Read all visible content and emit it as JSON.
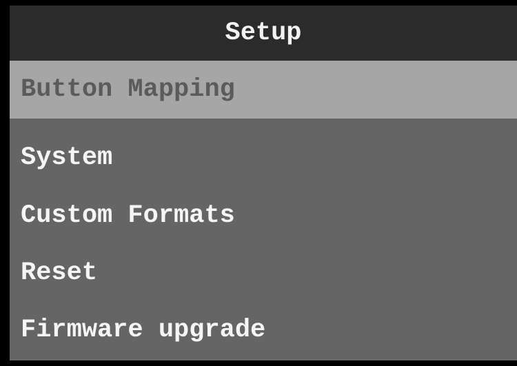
{
  "header": {
    "title": "Setup"
  },
  "menu": {
    "selected_index": 0,
    "items": [
      {
        "label": "Button Mapping"
      },
      {
        "label": "System"
      },
      {
        "label": "Custom Formats"
      },
      {
        "label": "Reset"
      },
      {
        "label": "Firmware upgrade"
      }
    ]
  },
  "colors": {
    "background": "#656565",
    "header_background": "#2b2b2b",
    "selected_background": "#a6a6a6",
    "selected_text": "#5b5b5b",
    "text": "#f5f5f5"
  }
}
